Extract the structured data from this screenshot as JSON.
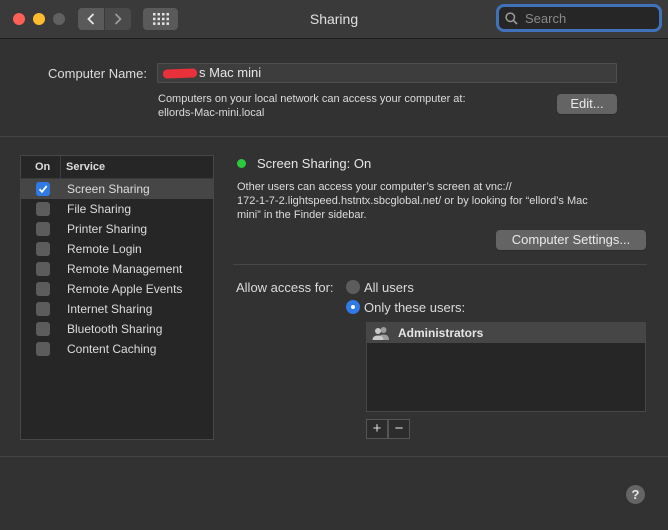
{
  "window": {
    "title": "Sharing"
  },
  "search": {
    "placeholder": "Search"
  },
  "computer_name": {
    "label": "Computer Name:",
    "value": "s Mac mini",
    "description_line1": "Computers on your local network can access your computer at:",
    "description_line2": "ellords-Mac-mini.local",
    "edit_label": "Edit..."
  },
  "services": {
    "header_on": "On",
    "header_service": "Service",
    "items": [
      {
        "label": "Screen Sharing",
        "checked": true,
        "selected": true
      },
      {
        "label": "File Sharing",
        "checked": false,
        "selected": false
      },
      {
        "label": "Printer Sharing",
        "checked": false,
        "selected": false
      },
      {
        "label": "Remote Login",
        "checked": false,
        "selected": false
      },
      {
        "label": "Remote Management",
        "checked": false,
        "selected": false
      },
      {
        "label": "Remote Apple Events",
        "checked": false,
        "selected": false
      },
      {
        "label": "Internet Sharing",
        "checked": false,
        "selected": false
      },
      {
        "label": "Bluetooth Sharing",
        "checked": false,
        "selected": false
      },
      {
        "label": "Content Caching",
        "checked": false,
        "selected": false
      }
    ]
  },
  "detail": {
    "status_title": "Screen Sharing: On",
    "status_color": "#2bc840",
    "description_line1": "Other users can access your computer’s screen at vnc://",
    "description_line2": "172-1-7-2.lightspeed.hstntx.sbcglobal.net/ or by looking for “ellord’s Mac",
    "description_line3": "mini” in the Finder sidebar.",
    "computer_settings_label": "Computer Settings...",
    "allow_access_label": "Allow access for:",
    "radio_all_users": "All users",
    "radio_only_these": "Only these users:",
    "selected_option": "Only these users:",
    "users": [
      {
        "name": "Administrators"
      }
    ],
    "add_label": "+",
    "remove_label": "−"
  },
  "help": {
    "label": "?"
  },
  "colors": {
    "accent": "#2f7ae5",
    "background": "#323232",
    "search_focus": "#3f72b9"
  }
}
